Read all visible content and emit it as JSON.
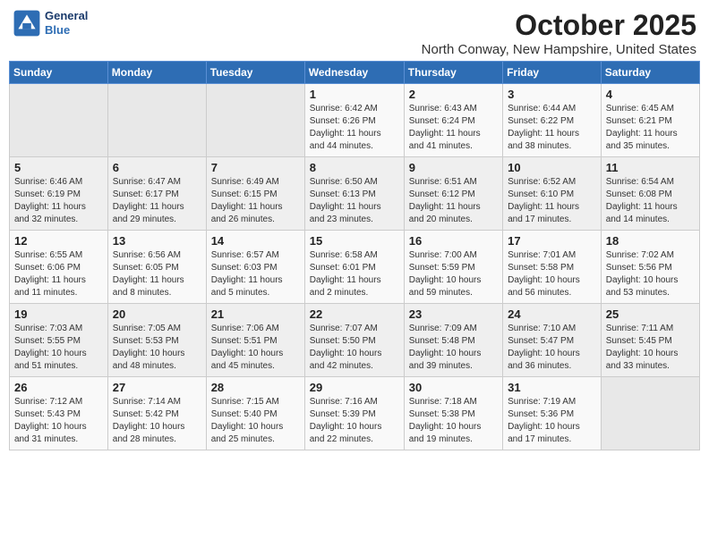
{
  "logo": {
    "line1": "General",
    "line2": "Blue"
  },
  "title": "October 2025",
  "location": "North Conway, New Hampshire, United States",
  "weekdays": [
    "Sunday",
    "Monday",
    "Tuesday",
    "Wednesday",
    "Thursday",
    "Friday",
    "Saturday"
  ],
  "weeks": [
    [
      {
        "day": "",
        "info": ""
      },
      {
        "day": "",
        "info": ""
      },
      {
        "day": "",
        "info": ""
      },
      {
        "day": "1",
        "info": "Sunrise: 6:42 AM\nSunset: 6:26 PM\nDaylight: 11 hours\nand 44 minutes."
      },
      {
        "day": "2",
        "info": "Sunrise: 6:43 AM\nSunset: 6:24 PM\nDaylight: 11 hours\nand 41 minutes."
      },
      {
        "day": "3",
        "info": "Sunrise: 6:44 AM\nSunset: 6:22 PM\nDaylight: 11 hours\nand 38 minutes."
      },
      {
        "day": "4",
        "info": "Sunrise: 6:45 AM\nSunset: 6:21 PM\nDaylight: 11 hours\nand 35 minutes."
      }
    ],
    [
      {
        "day": "5",
        "info": "Sunrise: 6:46 AM\nSunset: 6:19 PM\nDaylight: 11 hours\nand 32 minutes."
      },
      {
        "day": "6",
        "info": "Sunrise: 6:47 AM\nSunset: 6:17 PM\nDaylight: 11 hours\nand 29 minutes."
      },
      {
        "day": "7",
        "info": "Sunrise: 6:49 AM\nSunset: 6:15 PM\nDaylight: 11 hours\nand 26 minutes."
      },
      {
        "day": "8",
        "info": "Sunrise: 6:50 AM\nSunset: 6:13 PM\nDaylight: 11 hours\nand 23 minutes."
      },
      {
        "day": "9",
        "info": "Sunrise: 6:51 AM\nSunset: 6:12 PM\nDaylight: 11 hours\nand 20 minutes."
      },
      {
        "day": "10",
        "info": "Sunrise: 6:52 AM\nSunset: 6:10 PM\nDaylight: 11 hours\nand 17 minutes."
      },
      {
        "day": "11",
        "info": "Sunrise: 6:54 AM\nSunset: 6:08 PM\nDaylight: 11 hours\nand 14 minutes."
      }
    ],
    [
      {
        "day": "12",
        "info": "Sunrise: 6:55 AM\nSunset: 6:06 PM\nDaylight: 11 hours\nand 11 minutes."
      },
      {
        "day": "13",
        "info": "Sunrise: 6:56 AM\nSunset: 6:05 PM\nDaylight: 11 hours\nand 8 minutes."
      },
      {
        "day": "14",
        "info": "Sunrise: 6:57 AM\nSunset: 6:03 PM\nDaylight: 11 hours\nand 5 minutes."
      },
      {
        "day": "15",
        "info": "Sunrise: 6:58 AM\nSunset: 6:01 PM\nDaylight: 11 hours\nand 2 minutes."
      },
      {
        "day": "16",
        "info": "Sunrise: 7:00 AM\nSunset: 5:59 PM\nDaylight: 10 hours\nand 59 minutes."
      },
      {
        "day": "17",
        "info": "Sunrise: 7:01 AM\nSunset: 5:58 PM\nDaylight: 10 hours\nand 56 minutes."
      },
      {
        "day": "18",
        "info": "Sunrise: 7:02 AM\nSunset: 5:56 PM\nDaylight: 10 hours\nand 53 minutes."
      }
    ],
    [
      {
        "day": "19",
        "info": "Sunrise: 7:03 AM\nSunset: 5:55 PM\nDaylight: 10 hours\nand 51 minutes."
      },
      {
        "day": "20",
        "info": "Sunrise: 7:05 AM\nSunset: 5:53 PM\nDaylight: 10 hours\nand 48 minutes."
      },
      {
        "day": "21",
        "info": "Sunrise: 7:06 AM\nSunset: 5:51 PM\nDaylight: 10 hours\nand 45 minutes."
      },
      {
        "day": "22",
        "info": "Sunrise: 7:07 AM\nSunset: 5:50 PM\nDaylight: 10 hours\nand 42 minutes."
      },
      {
        "day": "23",
        "info": "Sunrise: 7:09 AM\nSunset: 5:48 PM\nDaylight: 10 hours\nand 39 minutes."
      },
      {
        "day": "24",
        "info": "Sunrise: 7:10 AM\nSunset: 5:47 PM\nDaylight: 10 hours\nand 36 minutes."
      },
      {
        "day": "25",
        "info": "Sunrise: 7:11 AM\nSunset: 5:45 PM\nDaylight: 10 hours\nand 33 minutes."
      }
    ],
    [
      {
        "day": "26",
        "info": "Sunrise: 7:12 AM\nSunset: 5:43 PM\nDaylight: 10 hours\nand 31 minutes."
      },
      {
        "day": "27",
        "info": "Sunrise: 7:14 AM\nSunset: 5:42 PM\nDaylight: 10 hours\nand 28 minutes."
      },
      {
        "day": "28",
        "info": "Sunrise: 7:15 AM\nSunset: 5:40 PM\nDaylight: 10 hours\nand 25 minutes."
      },
      {
        "day": "29",
        "info": "Sunrise: 7:16 AM\nSunset: 5:39 PM\nDaylight: 10 hours\nand 22 minutes."
      },
      {
        "day": "30",
        "info": "Sunrise: 7:18 AM\nSunset: 5:38 PM\nDaylight: 10 hours\nand 19 minutes."
      },
      {
        "day": "31",
        "info": "Sunrise: 7:19 AM\nSunset: 5:36 PM\nDaylight: 10 hours\nand 17 minutes."
      },
      {
        "day": "",
        "info": ""
      }
    ]
  ]
}
